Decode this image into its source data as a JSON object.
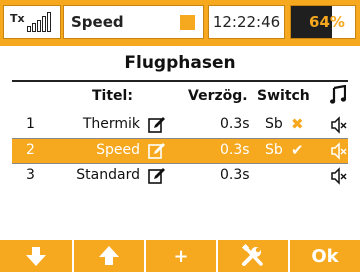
{
  "statusbar": {
    "tx_label": "Tx",
    "mode": "Speed",
    "time": "12:22:46",
    "battery_text": "64%",
    "battery_level": 0.64
  },
  "screen": {
    "title": "Flugphasen"
  },
  "table": {
    "headers": {
      "title": "Titel:",
      "delay": "Verzög.",
      "switch": "Switch",
      "sound": "music-note-icon"
    },
    "rows": [
      {
        "num": "1",
        "name": "Thermik",
        "delay": "0.3s",
        "switch": "Sb",
        "switch_mark": "✖"
      },
      {
        "num": "2",
        "name": "Speed",
        "delay": "0.3s",
        "switch": "Sb",
        "switch_mark": "✔"
      },
      {
        "num": "3",
        "name": "Standard",
        "delay": "0.3s",
        "switch": "",
        "switch_mark": ""
      }
    ]
  },
  "softkeys": {
    "down_icon": "arrow-down-icon",
    "up_icon": "arrow-up-icon",
    "add_label": "+",
    "tools_icon": "wrench-screwdriver-icon",
    "ok_label": "Ok"
  },
  "colors": {
    "accent": "#f6a81e",
    "text": "#111111",
    "battery_fill": "#1f1f1f"
  }
}
